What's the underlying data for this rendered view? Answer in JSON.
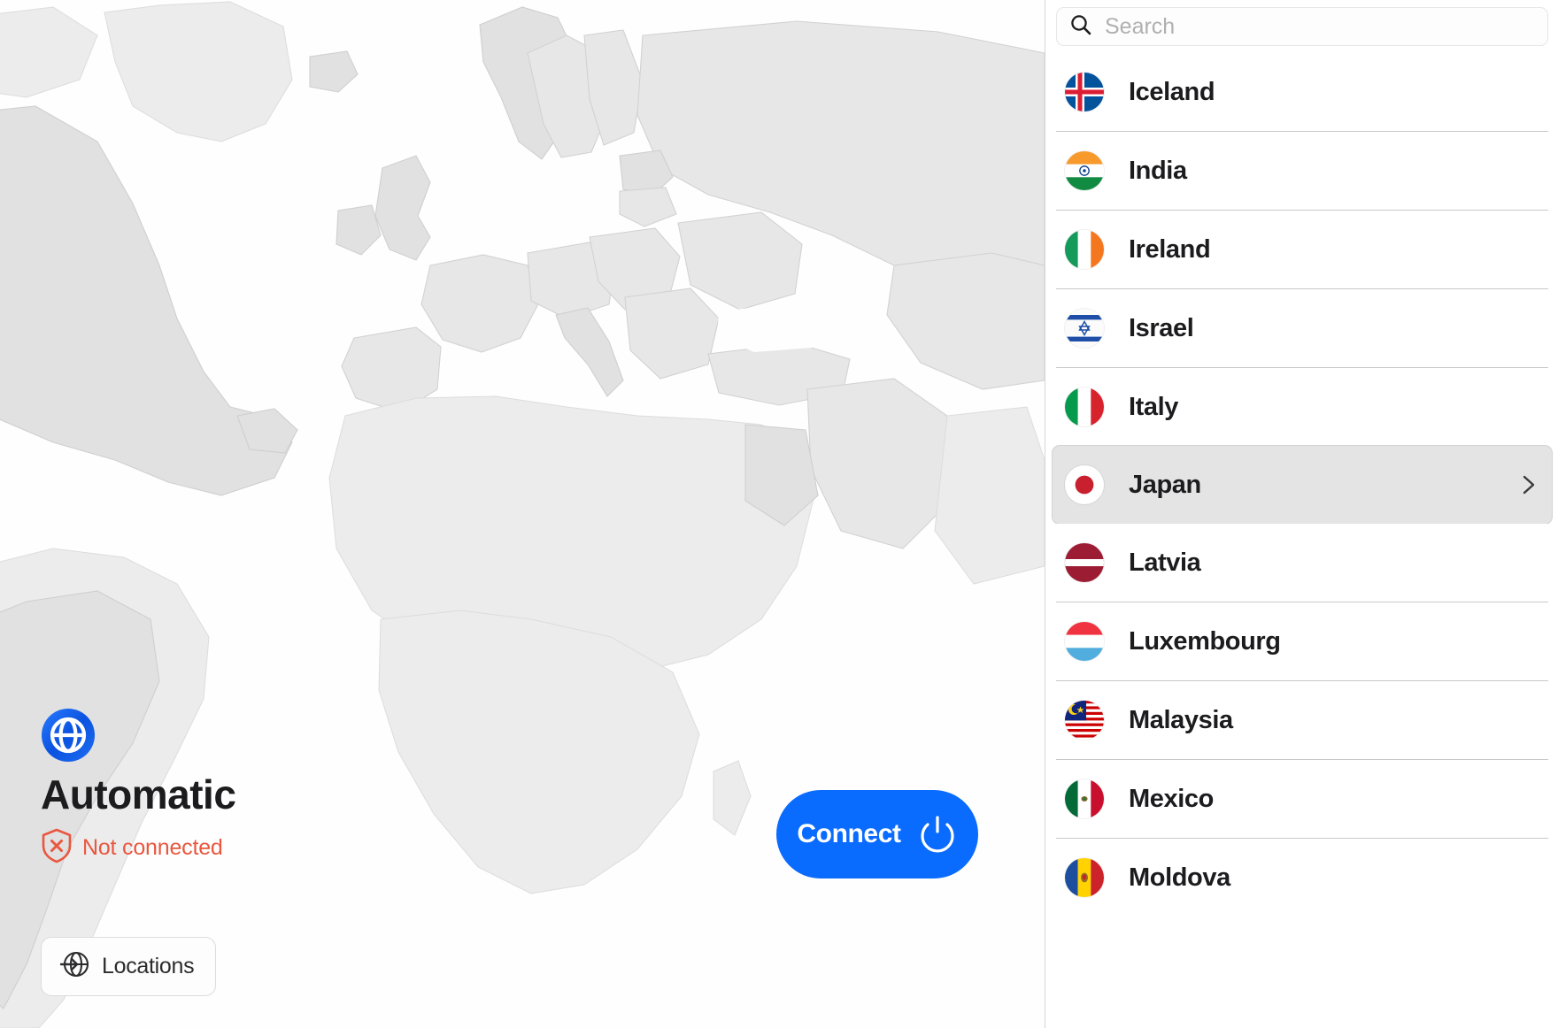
{
  "app": {
    "name": "VPN Location Picker"
  },
  "map": {
    "icon": "world-map",
    "background_color": "#fefefe",
    "land_color": "#e6e6e6",
    "border_color": "#d0d0d0"
  },
  "status": {
    "globe_icon": "globe-icon",
    "location_name": "Automatic",
    "shield_icon": "shield-x-icon",
    "status_text": "Not connected",
    "status_color": "#e9573f"
  },
  "connect": {
    "label": "Connect",
    "power_icon": "power-icon",
    "accent_color": "#0a6bff"
  },
  "locations_button": {
    "icon": "locations-globe-arrow-icon",
    "label": "Locations"
  },
  "search": {
    "icon": "search-icon",
    "placeholder": "Search",
    "value": ""
  },
  "list": {
    "selected": "Japan",
    "chevron_icon": "chevron-right-icon",
    "countries": [
      {
        "name": "Iceland",
        "flag": "flag-iceland",
        "selected": false
      },
      {
        "name": "India",
        "flag": "flag-india",
        "selected": false
      },
      {
        "name": "Ireland",
        "flag": "flag-ireland",
        "selected": false
      },
      {
        "name": "Israel",
        "flag": "flag-israel",
        "selected": false
      },
      {
        "name": "Italy",
        "flag": "flag-italy",
        "selected": false
      },
      {
        "name": "Japan",
        "flag": "flag-japan",
        "selected": true
      },
      {
        "name": "Latvia",
        "flag": "flag-latvia",
        "selected": false
      },
      {
        "name": "Luxembourg",
        "flag": "flag-luxembourg",
        "selected": false
      },
      {
        "name": "Malaysia",
        "flag": "flag-malaysia",
        "selected": false
      },
      {
        "name": "Mexico",
        "flag": "flag-mexico",
        "selected": false
      },
      {
        "name": "Moldova",
        "flag": "flag-moldova",
        "selected": false
      }
    ]
  }
}
